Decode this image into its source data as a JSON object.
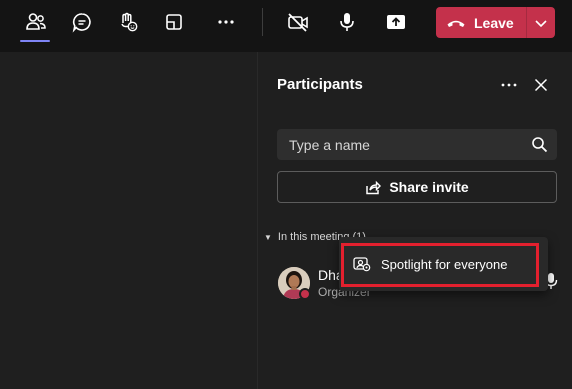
{
  "toolbar": {
    "buttons": [
      {
        "name": "people-icon"
      },
      {
        "name": "chat-icon"
      },
      {
        "name": "raise-hand-icon"
      },
      {
        "name": "rooms-icon"
      },
      {
        "name": "more-icon"
      },
      {
        "name": "camera-off-icon"
      },
      {
        "name": "mic-icon"
      },
      {
        "name": "share-tray-icon"
      }
    ],
    "leave_label": "Leave",
    "leave_color": "#c4314b",
    "active_underline_color": "#7f85f5"
  },
  "panel": {
    "title": "Participants",
    "search_placeholder": "Type a name",
    "share_label": "Share invite",
    "section_label": "In this meeting (1)",
    "participants": [
      {
        "name": "Dha",
        "role": "Organizer",
        "presence_color": "#c4314b"
      }
    ]
  },
  "context_menu": {
    "items": [
      {
        "label": "Spotlight for everyone",
        "icon": "spotlight-icon"
      }
    ],
    "highlight_color": "#e3202e"
  }
}
